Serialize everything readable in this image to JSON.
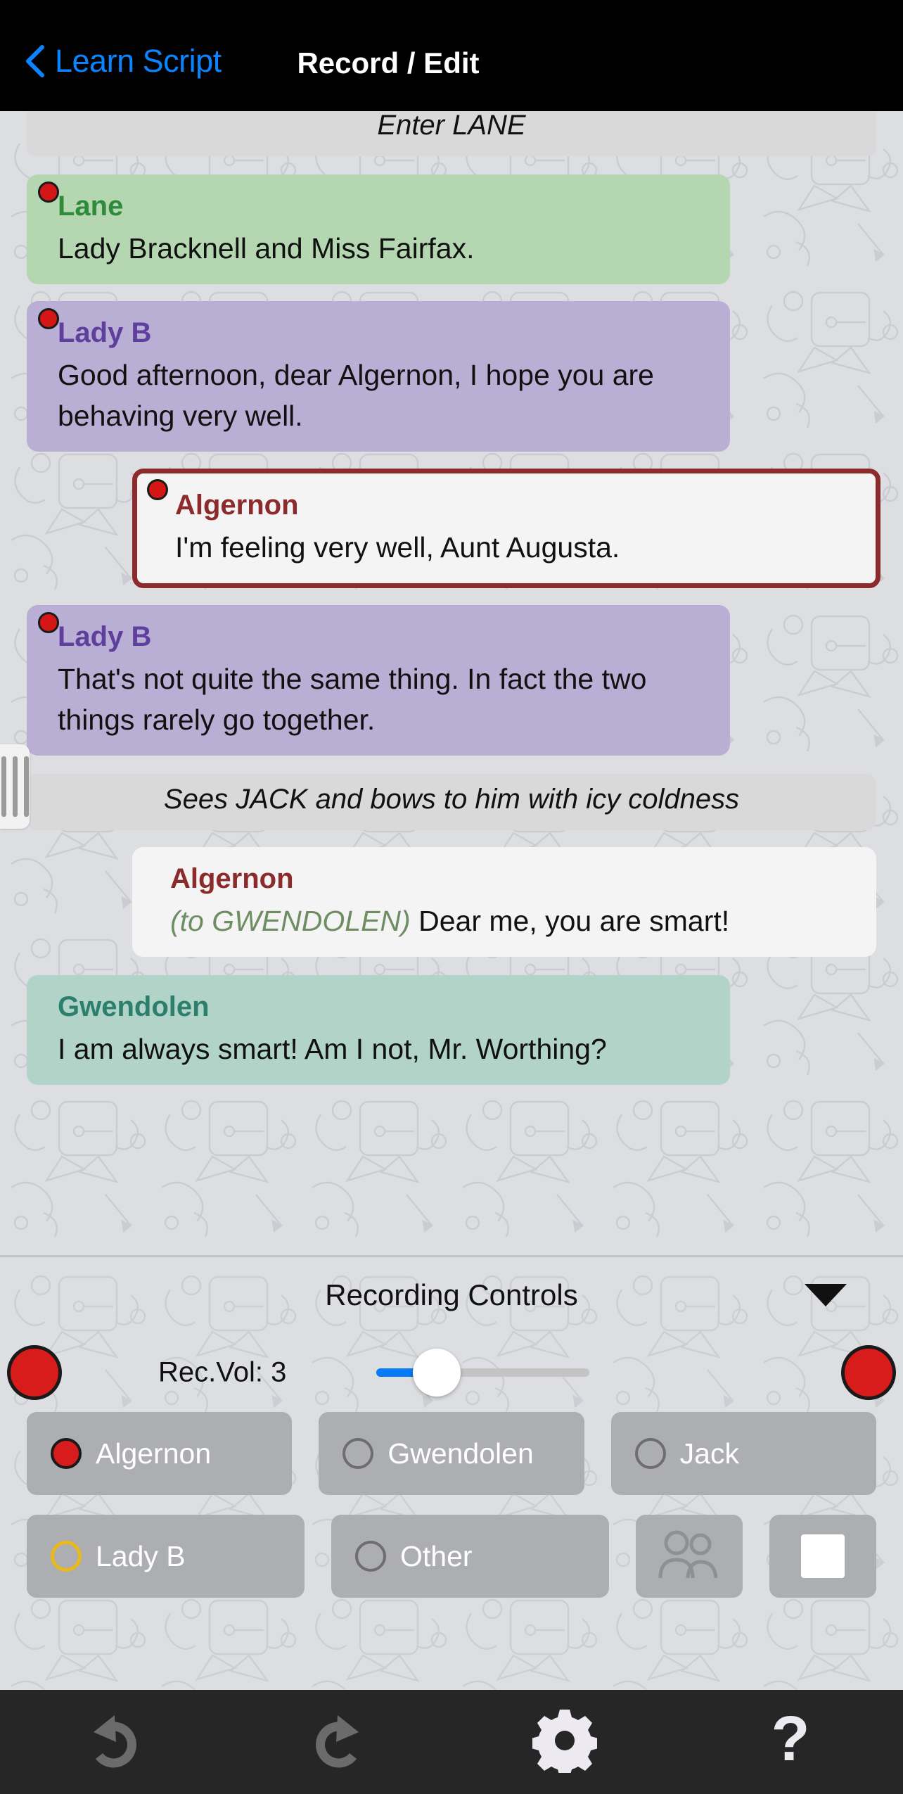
{
  "navbar": {
    "back_label": "Learn Script",
    "back_icon": "chevron-left-icon",
    "title": "Record / Edit"
  },
  "script": {
    "items": [
      {
        "kind": "stage",
        "text": "Enter LANE"
      },
      {
        "kind": "line",
        "speaker": "Lane",
        "text": "Lady Bracknell and Miss Fairfax.",
        "marker": "record-dot"
      },
      {
        "kind": "line",
        "speaker": "Lady B",
        "text": "Good afternoon, dear Algernon, I hope you are behaving very well.",
        "marker": "record-dot"
      },
      {
        "kind": "line",
        "speaker": "Algernon",
        "text": "I'm feeling very well, Aunt Augusta.",
        "marker": "record-dot",
        "selected": true
      },
      {
        "kind": "line",
        "speaker": "Lady B",
        "text": "That's not quite the same thing. In fact the two things rarely go together.",
        "marker": "record-dot"
      },
      {
        "kind": "stage",
        "text": "Sees JACK and bows to him with icy coldness"
      },
      {
        "kind": "line",
        "speaker": "Algernon",
        "direction": "(to GWENDOLEN)",
        "text": "Dear me, you are smart!"
      },
      {
        "kind": "line",
        "speaker": "Gwendolen",
        "text": "I am always smart! Am I not, Mr. Worthing?"
      }
    ],
    "drag_handle": "resize-handle"
  },
  "controls": {
    "title": "Recording Controls",
    "collapse_icon": "chevron-down-icon",
    "record_left": "record-button-left",
    "record_right": "record-button-right",
    "volume_label": "Rec.Vol: 3",
    "volume_value": 3,
    "characters": [
      {
        "label": "Algernon",
        "state": "filled"
      },
      {
        "label": "Gwendolen",
        "state": "empty"
      },
      {
        "label": "Jack",
        "state": "empty"
      },
      {
        "label": "Lady B",
        "state": "gold"
      },
      {
        "label": "Other",
        "state": "empty"
      }
    ],
    "group_button_icon": "people-icon",
    "stop_button_icon": "stop-square-icon"
  },
  "toolbar": {
    "items": [
      {
        "name": "undo-icon",
        "label": "Undo"
      },
      {
        "name": "redo-icon",
        "label": "Redo"
      },
      {
        "name": "gear-icon",
        "label": "Settings"
      },
      {
        "name": "help-icon",
        "label": "Help"
      }
    ]
  },
  "colors": {
    "accent_blue": "#0a84ff",
    "record_red": "#d81b1b",
    "lane_bubble": "#b4d6b0",
    "lane_name": "#2f8a3c",
    "ladyb_bubble": "#b9aed3",
    "ladyb_name": "#5f3f9e",
    "algernon_name": "#8b2b2b",
    "algernon_border": "#8b2b2b",
    "gwendolen_bubble": "#b1d3c8",
    "gwendolen_name": "#2c7f6d",
    "direction_green": "#6e8d63",
    "gold_ring": "#e8b81c"
  }
}
